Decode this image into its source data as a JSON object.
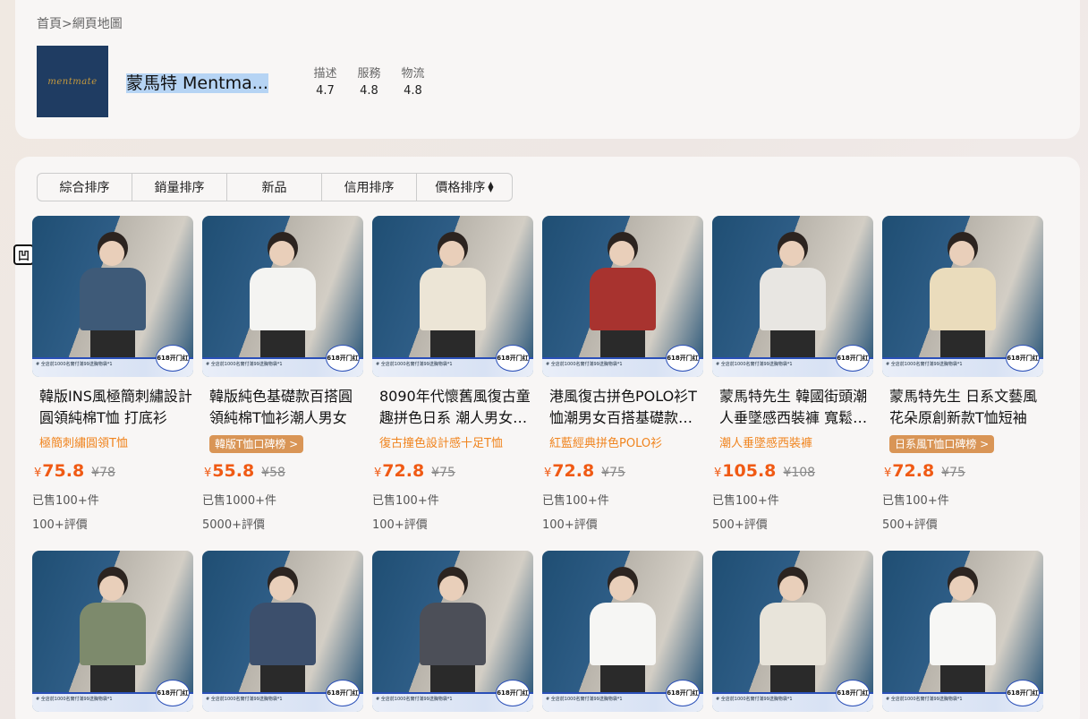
{
  "breadcrumb": {
    "home": "首頁",
    "sep": ">",
    "current": "網頁地圖"
  },
  "shop": {
    "logo_text": "mentmate",
    "name": "蒙馬特 Mentma...",
    "ratings": [
      {
        "label": "描述",
        "value": "4.7"
      },
      {
        "label": "服務",
        "value": "4.8"
      },
      {
        "label": "物流",
        "value": "4.8"
      }
    ]
  },
  "sort": {
    "comprehensive": "綜合排序",
    "sales": "銷量排序",
    "new": "新品",
    "credit": "信用排序",
    "price": "價格排序"
  },
  "side_badge": "凹",
  "banner": {
    "promo": "# 全店前1000名實付滿99送胸物袋*1",
    "badge": "618开门红"
  },
  "products": [
    {
      "title": "韓版INS風極簡刺繡設計圓領純棉T恤 打底衫",
      "tag": "極簡刺繡圓領T恤",
      "tag_style": "text",
      "price": "75.8",
      "orig": "78",
      "sold": "已售100+件",
      "reviews": "100+評價",
      "torso": "#3e5a78"
    },
    {
      "title": "韓版純色基礎款百搭圓領純棉T恤衫潮人男女",
      "tag": "韓版T恤口碑榜 >",
      "tag_style": "pill",
      "price": "55.8",
      "orig": "58",
      "sold": "已售1000+件",
      "reviews": "5000+評價",
      "torso": "#f4f4f2"
    },
    {
      "title": "8090年代懷舊風復古童趣拼色日系 潮人男女T恤",
      "tag": "復古撞色設計感十足T恤",
      "tag_style": "text",
      "price": "72.8",
      "orig": "75",
      "sold": "已售100+件",
      "reviews": "100+評價",
      "torso": "#ece5d6"
    },
    {
      "title": "港風復古拼色POLO衫T恤潮男女百搭基礎款上衣",
      "tag": "紅藍經典拼色POLO衫",
      "tag_style": "text",
      "price": "72.8",
      "orig": "75",
      "sold": "已售100+件",
      "reviews": "100+評價",
      "torso": "#a8332f"
    },
    {
      "title": "蒙馬特先生 韓國街頭潮人垂墜感西裝褲 寬鬆直筒",
      "tag": "潮人垂墜感西裝褲",
      "tag_style": "text",
      "price": "105.8",
      "orig": "108",
      "sold": "已售100+件",
      "reviews": "500+評價",
      "torso": "#e8e6e2"
    },
    {
      "title": "蒙馬特先生 日系文藝風花朵原創新款T恤短袖",
      "tag": "日系風T恤口碑榜 >",
      "tag_style": "pill",
      "price": "72.8",
      "orig": "75",
      "sold": "已售100+件",
      "reviews": "500+評價",
      "torso": "#eadcbc"
    },
    {
      "title": "",
      "torso": "#7d8a6c"
    },
    {
      "title": "",
      "torso": "#3c4f6c"
    },
    {
      "title": "",
      "torso": "#4c4f58"
    },
    {
      "title": "",
      "torso": "#f6f6f4"
    },
    {
      "title": "",
      "torso": "#e8e4da"
    },
    {
      "title": "",
      "torso": "#f7f7f5"
    }
  ]
}
